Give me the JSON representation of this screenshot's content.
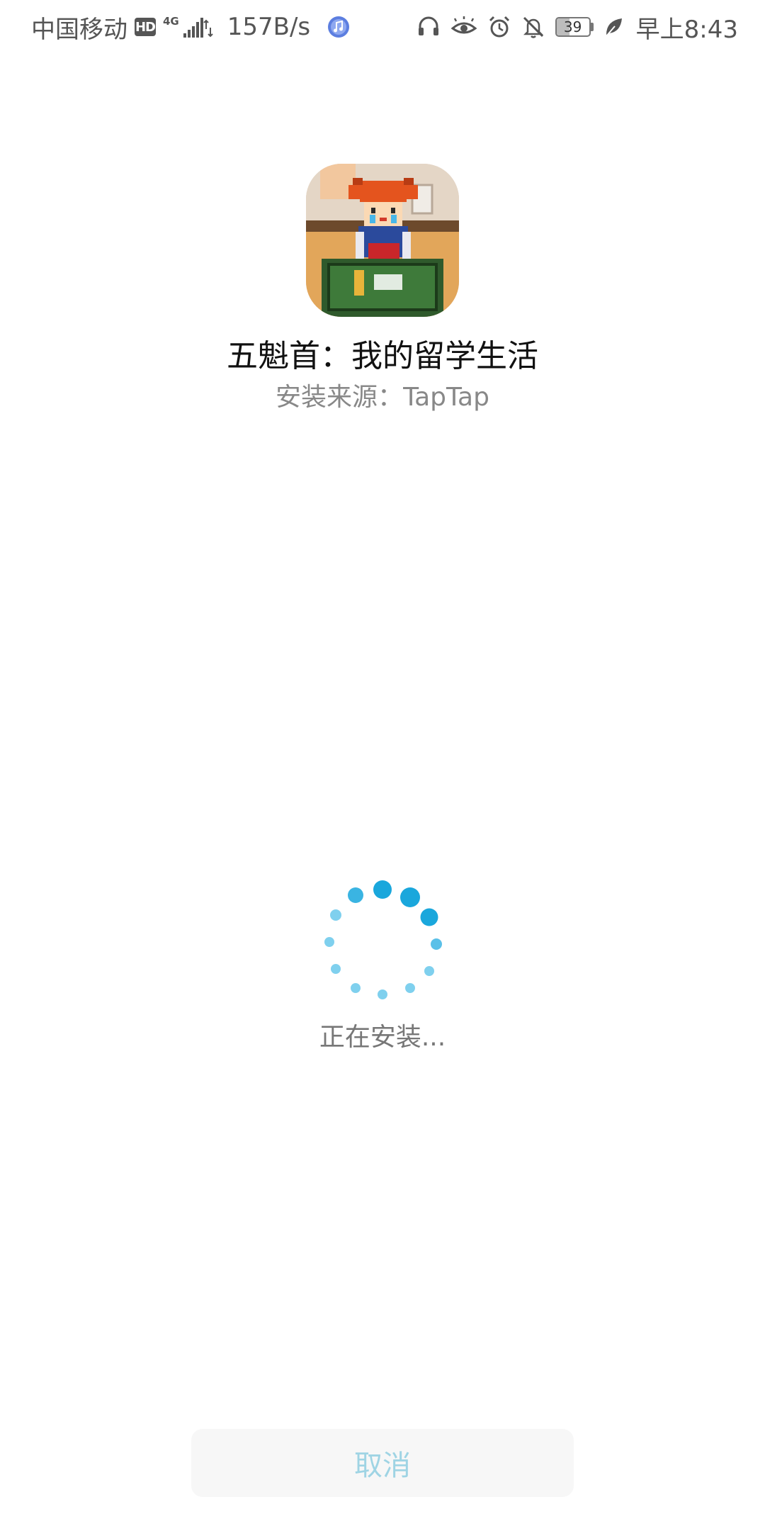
{
  "status_bar": {
    "carrier": "中国移动",
    "hd_badge": "HD",
    "network_type": "4G",
    "net_speed": "157B/s",
    "battery_level": "39",
    "battery_fraction": 0.39,
    "time": "早上8:43",
    "icons": [
      "hd-icon",
      "signal-icon",
      "music-app-icon",
      "headset-icon",
      "eye-comfort-icon",
      "alarm-icon",
      "mute-bell-icon",
      "battery-icon",
      "leaf-power-saving-icon"
    ]
  },
  "app": {
    "name": "五魁首：我的留学生活",
    "source_label": "安装来源：",
    "source_value": "TapTap"
  },
  "install": {
    "status": "正在安装..."
  },
  "actions": {
    "cancel_label": "取消"
  },
  "colors": {
    "spinner": "#1aa7dc",
    "spinner_light": "#7fd0ee",
    "cancel_text": "#9fd4e4",
    "status_bar_text": "#555555"
  }
}
